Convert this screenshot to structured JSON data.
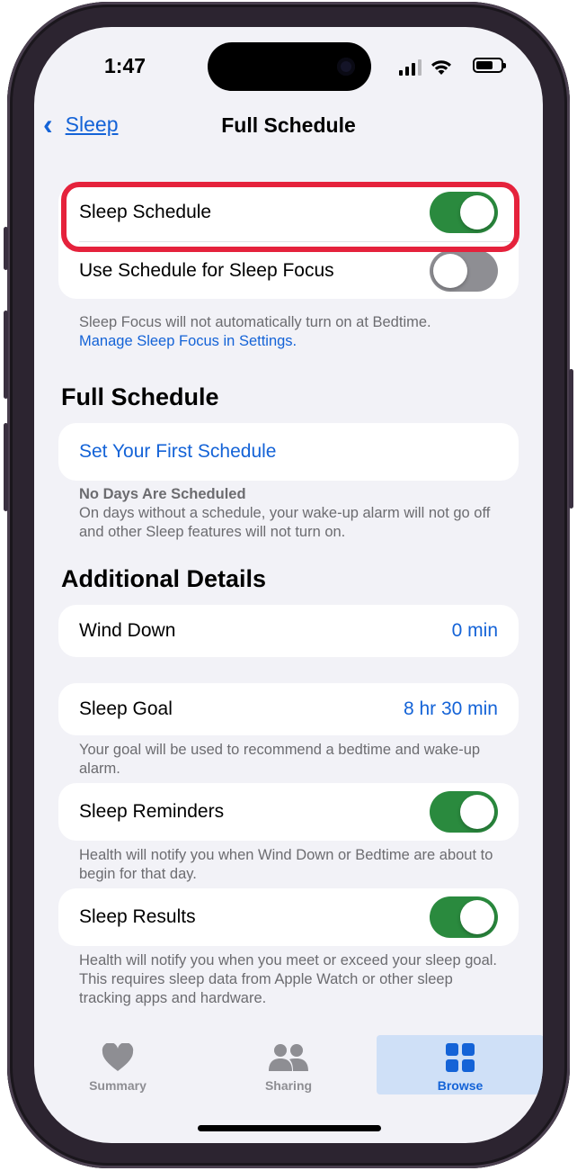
{
  "status": {
    "time": "1:47"
  },
  "nav": {
    "back_label": "Sleep",
    "title": "Full Schedule"
  },
  "toggles_card": {
    "sleep_schedule": {
      "label": "Sleep Schedule",
      "on": true
    },
    "sleep_focus": {
      "label": "Use Schedule for Sleep Focus",
      "on": false
    }
  },
  "focus_note": {
    "text": "Sleep Focus will not automatically turn on at Bedtime.",
    "link": "Manage Sleep Focus in Settings."
  },
  "full_schedule": {
    "heading": "Full Schedule",
    "set_first": "Set Your First Schedule",
    "note_title": "No Days Are Scheduled",
    "note_text": "On days without a schedule, your wake-up alarm will not go off and other Sleep features will not turn on."
  },
  "additional": {
    "heading": "Additional Details",
    "wind_down": {
      "label": "Wind Down",
      "value": "0 min"
    },
    "sleep_goal": {
      "label": "Sleep Goal",
      "value": "8 hr 30 min",
      "note": "Your goal will be used to recommend a bedtime and wake-up alarm."
    },
    "sleep_reminders": {
      "label": "Sleep Reminders",
      "on": true,
      "note": "Health will notify you when Wind Down or Bedtime are about to begin for that day."
    },
    "sleep_results": {
      "label": "Sleep Results",
      "on": true,
      "note": "Health will notify you when you meet or exceed your sleep goal. This requires sleep data from Apple Watch or other sleep tracking apps and hardware."
    }
  },
  "tabs": [
    {
      "label": "Summary",
      "icon": "heart-icon",
      "active": false
    },
    {
      "label": "Sharing",
      "icon": "people-icon",
      "active": false
    },
    {
      "label": "Browse",
      "icon": "grid-icon",
      "active": true
    }
  ],
  "colors": {
    "accent": "#1463d7",
    "toggle_on": "#2a8a3e",
    "highlight": "#e5223c",
    "background": "#f2f2f7"
  }
}
